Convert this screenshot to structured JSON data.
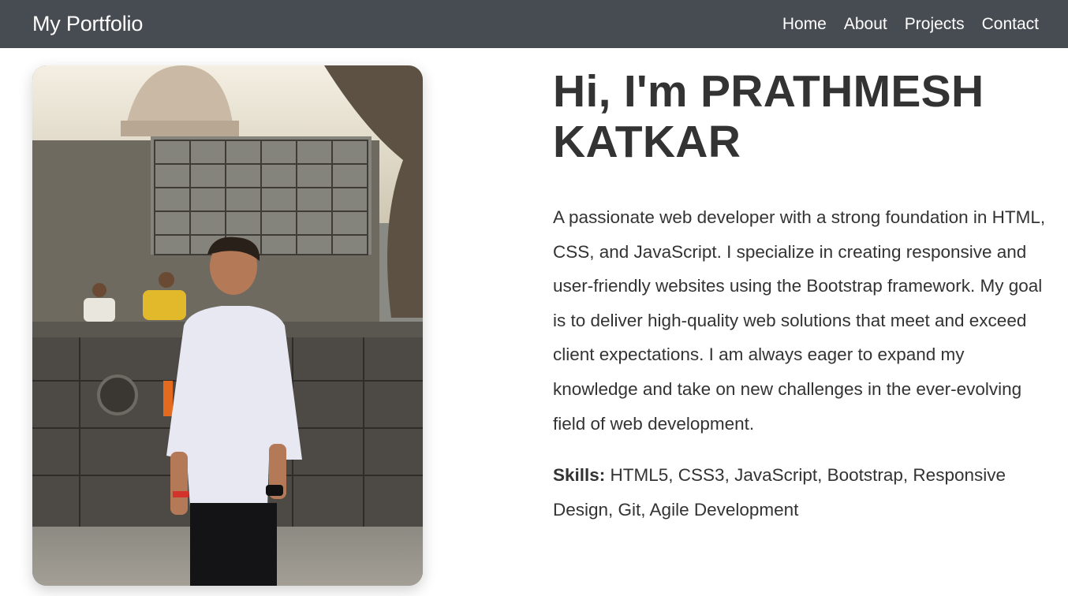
{
  "navbar": {
    "brand": "My Portfolio",
    "links": [
      "Home",
      "About",
      "Projects",
      "Contact"
    ]
  },
  "hero": {
    "photo_icon": "profile-photo",
    "greeting": "Hi, I'm PRATHMESH KATKAR",
    "bio": "A passionate web developer with a strong foundation in HTML, CSS, and JavaScript. I specialize in creating responsive and user-friendly websites using the Bootstrap framework. My goal is to deliver high-quality web solutions that meet and exceed client expectations. I am always eager to expand my knowledge and take on new challenges in the ever-evolving field of web development.",
    "skills_label": "Skills:",
    "skills_value": " HTML5, CSS3, JavaScript, Bootstrap, Responsive Design, Git, Agile Development"
  },
  "colors": {
    "navbar_bg": "#474b52",
    "text": "#333333",
    "nav_text": "#ffffff"
  }
}
